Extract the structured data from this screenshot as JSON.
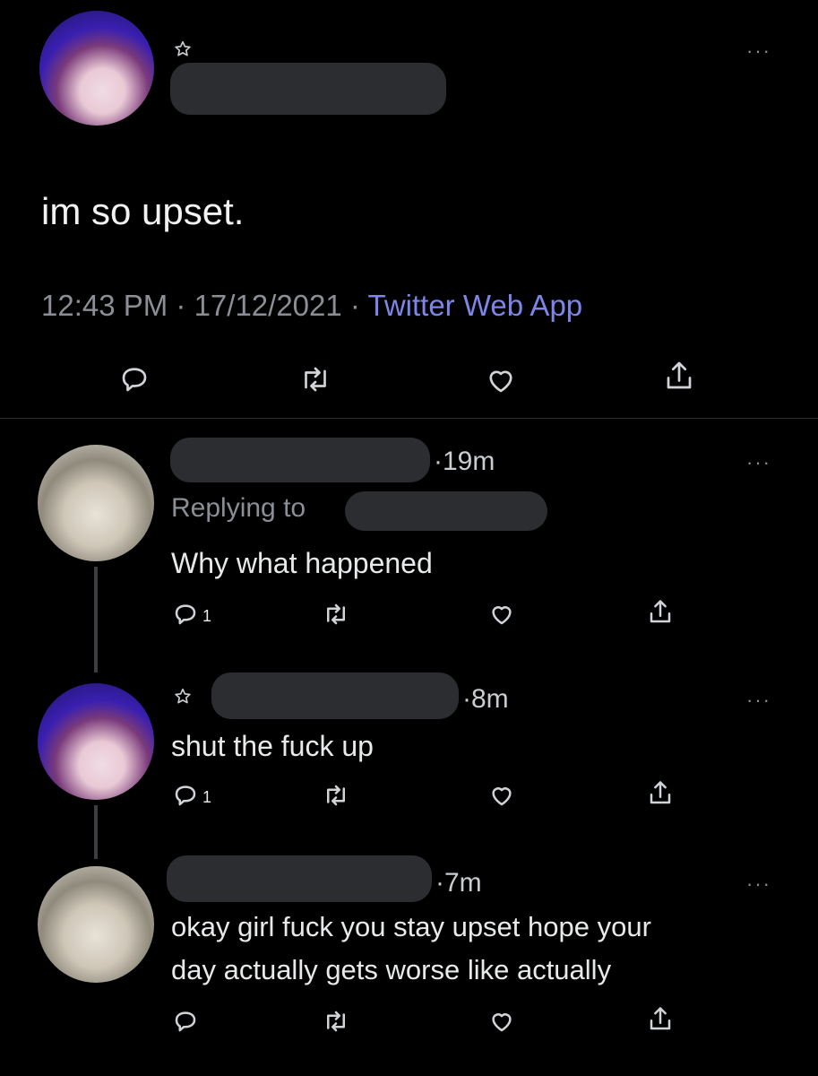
{
  "main_tweet": {
    "text": "im so upset.",
    "time": "12:43 PM",
    "sep1": " · ",
    "date": "17/12/2021",
    "sep2": " · ",
    "source": "Twitter Web App",
    "menu": "···"
  },
  "replies": [
    {
      "age": "·19m",
      "replying_label": "Replying to",
      "text": "Why what happened",
      "reply_count": "1",
      "menu": "···"
    },
    {
      "age": "·8m",
      "text": "shut the fuck up",
      "reply_count": "1",
      "menu": "···"
    },
    {
      "age": "·7m",
      "text_line1": "okay girl fuck you stay upset hope your",
      "text_line2": "day actually gets worse like actually",
      "menu": "···"
    }
  ],
  "colors": {
    "background": "#000000",
    "text": "#e7e9ea",
    "muted": "#8b8f95",
    "link": "#7d86e8",
    "redaction": "#2b2d31"
  },
  "icons": [
    "star-icon",
    "reply-icon",
    "retweet-icon",
    "like-icon",
    "share-icon",
    "more-icon"
  ]
}
